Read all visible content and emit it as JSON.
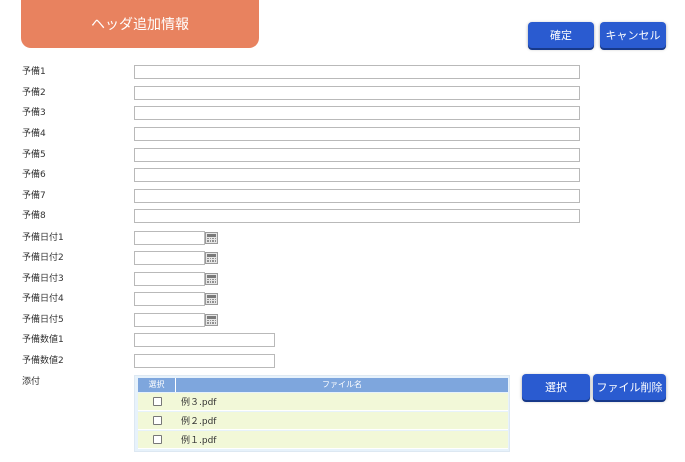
{
  "header": {
    "title": "ヘッダ追加情報",
    "confirm_label": "確定",
    "cancel_label": "キャンセル"
  },
  "fields": {
    "text": [
      {
        "label": "予備1",
        "value": ""
      },
      {
        "label": "予備2",
        "value": ""
      },
      {
        "label": "予備3",
        "value": ""
      },
      {
        "label": "予備4",
        "value": ""
      },
      {
        "label": "予備5",
        "value": ""
      },
      {
        "label": "予備6",
        "value": ""
      },
      {
        "label": "予備7",
        "value": ""
      },
      {
        "label": "予備8",
        "value": ""
      }
    ],
    "date": [
      {
        "label": "予備日付1",
        "value": ""
      },
      {
        "label": "予備日付2",
        "value": ""
      },
      {
        "label": "予備日付3",
        "value": ""
      },
      {
        "label": "予備日付4",
        "value": ""
      },
      {
        "label": "予備日付5",
        "value": ""
      }
    ],
    "number": [
      {
        "label": "予備数値1",
        "value": ""
      },
      {
        "label": "予備数値2",
        "value": ""
      }
    ]
  },
  "attachment": {
    "label": "添付",
    "col_select": "選択",
    "col_filename": "ファイル名",
    "files": [
      {
        "name": "例３.pdf",
        "checked": false
      },
      {
        "name": "例２.pdf",
        "checked": false
      },
      {
        "name": "例１.pdf",
        "checked": false
      }
    ],
    "select_label": "選択",
    "delete_label": "ファイル削除"
  },
  "colors": {
    "header_tab": "#e8825f",
    "button": "#2a5bd0",
    "table_header": "#7ea6dd",
    "table_row": "#f2f8d8"
  }
}
